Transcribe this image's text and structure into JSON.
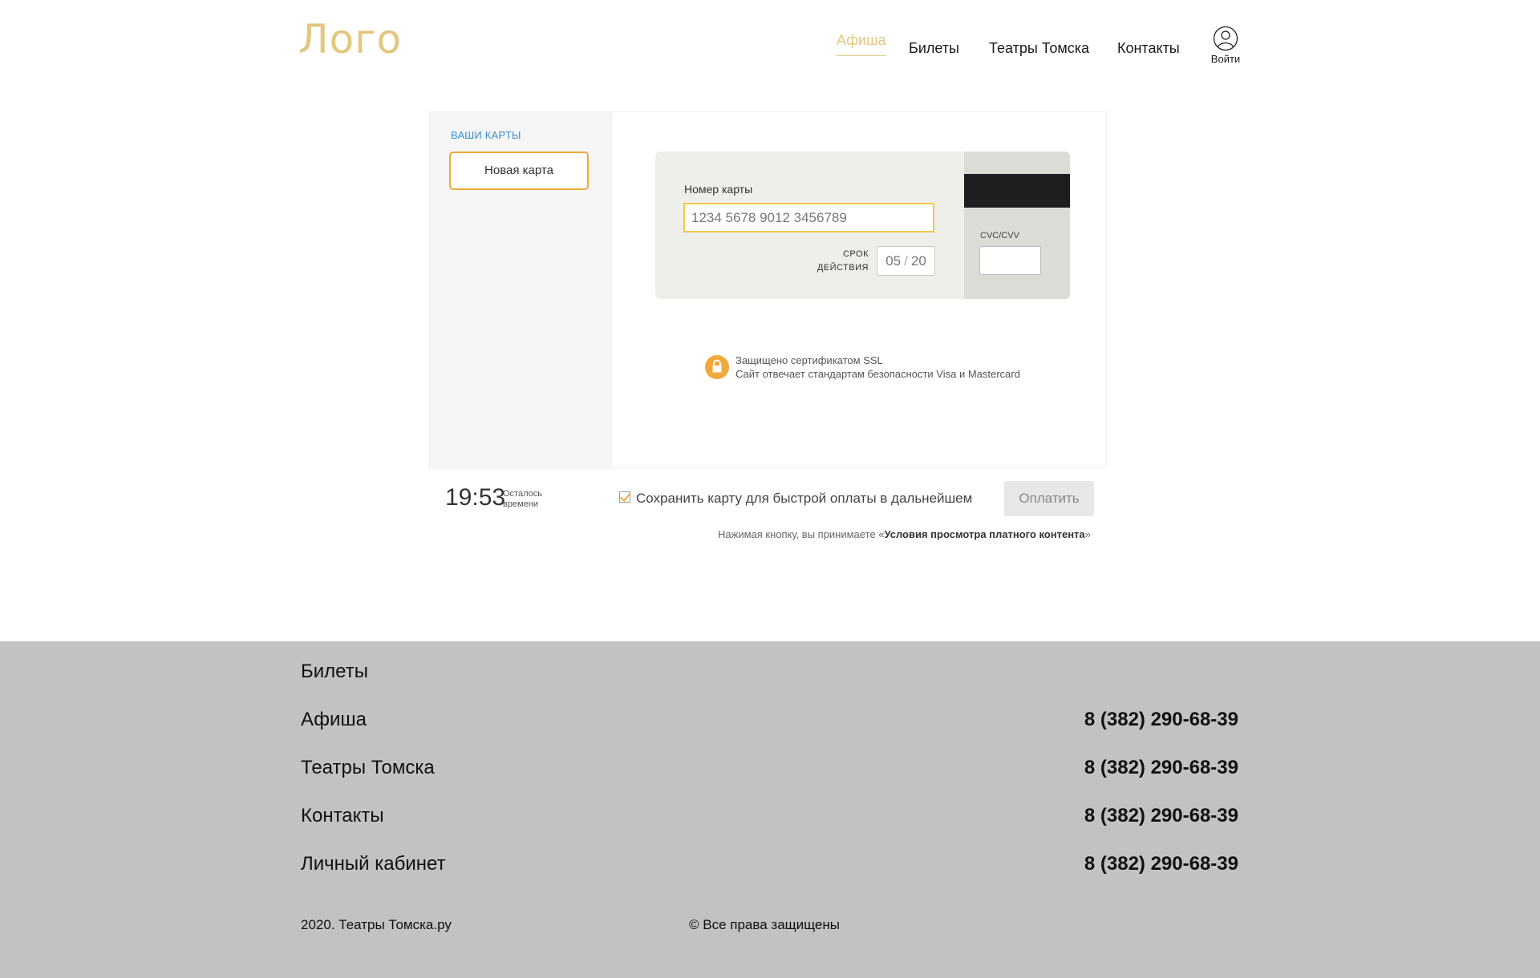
{
  "header": {
    "logo": "Лого",
    "nav": [
      "Афиша",
      "Билеты",
      "Театры Томска",
      "Контакты"
    ],
    "login_label": "Войти"
  },
  "payment": {
    "sidebar_title": "ВАШИ КАРТЫ",
    "new_card": "Новая карта",
    "card_number_label": "Номер карты",
    "card_number_value": "1234 5678 9012 3456789",
    "expiry_label_line1": "СРОК",
    "expiry_label_line2": "ДЕЙСТВИЯ",
    "expiry_month": "05",
    "expiry_sep": "/",
    "expiry_year": "20",
    "cvc_label": "CVC/CVV",
    "ssl_line1": "Защищено сертификатом SSL",
    "ssl_line2": "Сайт отвечает стандартам безопасности Visa и Mastercard",
    "timer": "19:53",
    "timer_label_line1": "Осталось",
    "timer_label_line2": "времени",
    "save_card_label": "Сохранить карту для быстрой оплаты в дальнейшем",
    "save_card_checked": true,
    "pay_button": "Оплатить",
    "terms_prefix": "Нажимая кнопку, вы принимаете «",
    "terms_link": "Условия просмотра платного контента",
    "terms_suffix": "»"
  },
  "footer": {
    "links": [
      "Билеты",
      "Афиша",
      "Театры Томска",
      "Контакты",
      "Личный кабинет"
    ],
    "phones": [
      "8 (382) 290-68-39",
      "8 (382) 290-68-39",
      "8 (382) 290-68-39",
      "8 (382) 290-68-39"
    ],
    "copyright_left": "2020. Театры Томска.ру",
    "copyright_right": "© Все права защищены"
  },
  "colors": {
    "accent_gold": "#e3c77f",
    "accent_orange": "#f0a93a",
    "link_blue": "#3b8fd5",
    "footer_bg": "#c2c2c2"
  }
}
